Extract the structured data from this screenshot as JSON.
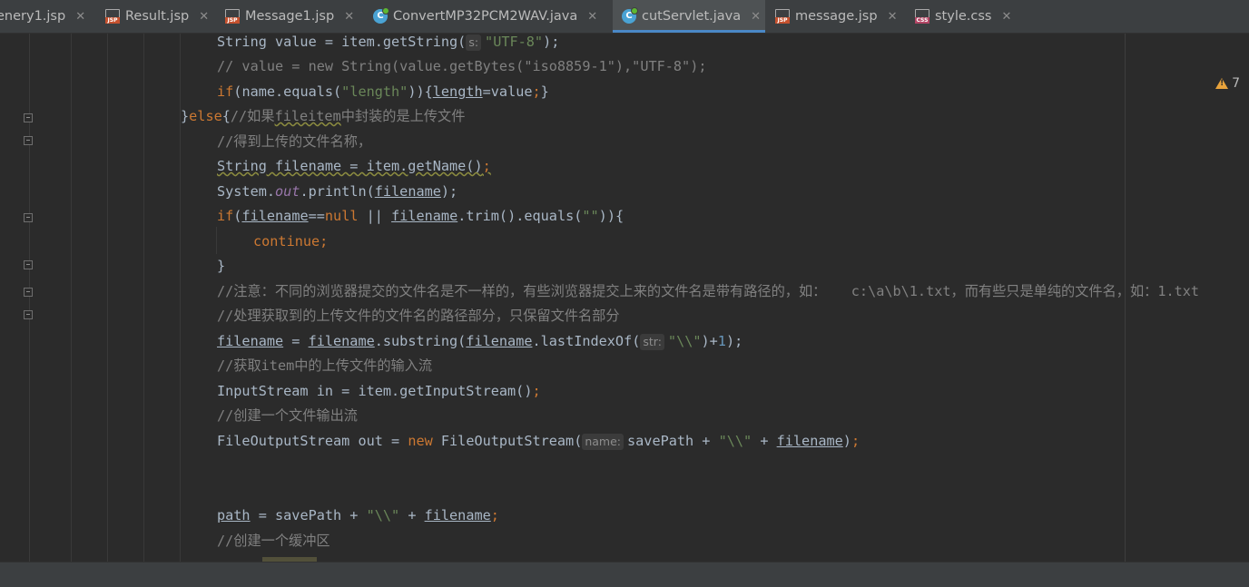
{
  "tabs": [
    {
      "name": "enery1.jsp",
      "type": "jsp",
      "active": false
    },
    {
      "name": "Result.jsp",
      "type": "jsp",
      "active": false
    },
    {
      "name": "Message1.jsp",
      "type": "jsp",
      "active": false
    },
    {
      "name": "ConvertMP32PCM2WAV.java",
      "type": "java",
      "active": false
    },
    {
      "name": "cutServlet.java",
      "type": "java",
      "active": true
    },
    {
      "name": "message.jsp",
      "type": "jsp",
      "active": false
    },
    {
      "name": "style.css",
      "type": "css",
      "active": false
    }
  ],
  "close_glyph": "✕",
  "java_glyph": "C",
  "warnings": {
    "icon": "warning-icon",
    "count": "7"
  },
  "code": {
    "l1a": "String value = item.getString(",
    "l1_hint": "s:",
    "l1_str": "\"UTF-8\"",
    "l1b": ");",
    "l2": "// value = new String(value.getBytes(\"iso8859-1\"),\"UTF-8\");",
    "l3_if": "if",
    "l3a": "(name.equals(",
    "l3_str": "\"length\"",
    "l3b": ")){",
    "l3_var": "length",
    "l3c": "=value",
    "l3_semi": ";",
    "l3d": "}",
    "l4a": "}",
    "l4_else": "else",
    "l4b": "{",
    "l4_c1": "//如果",
    "l4_c2": "fileitem",
    "l4_c3": "中封装的是上传文件",
    "l5": "//得到上传的文件名称，",
    "l6a": "String filename = item.getName()",
    "l6_semi": ";",
    "l7a": "System.",
    "l7_out": "out",
    "l7b": ".println(",
    "l7_var": "filename",
    "l7c": ");",
    "l8_if": "if",
    "l8a": "(",
    "l8_var1": "filename",
    "l8b": "==",
    "l8_null": "null",
    "l8c": " || ",
    "l8_var2": "filename",
    "l8d": ".trim().equals(",
    "l8_str": "\"\"",
    "l8e": ")){",
    "l9": "continue;",
    "l10": "}",
    "l11": "//注意：不同的浏览器提交的文件名是不一样的，有些浏览器提交上来的文件名是带有路径的，如：   c:\\a\\b\\1.txt，而有些只是单纯的文件名，如：1.txt",
    "l12": "//处理获取到的上传文件的文件名的路径部分，只保留文件名部分",
    "l13_var1": "filename",
    "l13a": " = ",
    "l13_var2": "filename",
    "l13b": ".substring(",
    "l13_var3": "filename",
    "l13c": ".lastIndexOf(",
    "l13_hint": "str:",
    "l13_str": "\"\\\\\"",
    "l13d": ")+",
    "l13_num": "1",
    "l13e": ");",
    "l14": "//获取item中的上传文件的输入流",
    "l15a": "InputStream in = item.getInputStream()",
    "l15_semi": ";",
    "l16": "//创建一个文件输出流",
    "l17a": "FileOutputStream out = ",
    "l17_new": "new",
    "l17b": " FileOutputStream(",
    "l17_hint": "name:",
    "l17c": "savePath + ",
    "l17_str": "\"\\\\\"",
    "l17d": " + ",
    "l17_var": "filename",
    "l17e": ")",
    "l17_semi": ";",
    "l18_var": "path",
    "l18a": " = savePath + ",
    "l18_str": "\"\\\\\"",
    "l18b": " + ",
    "l18_var2": "filename",
    "l18_semi": ";",
    "l19": "//创建一个缓冲区"
  }
}
